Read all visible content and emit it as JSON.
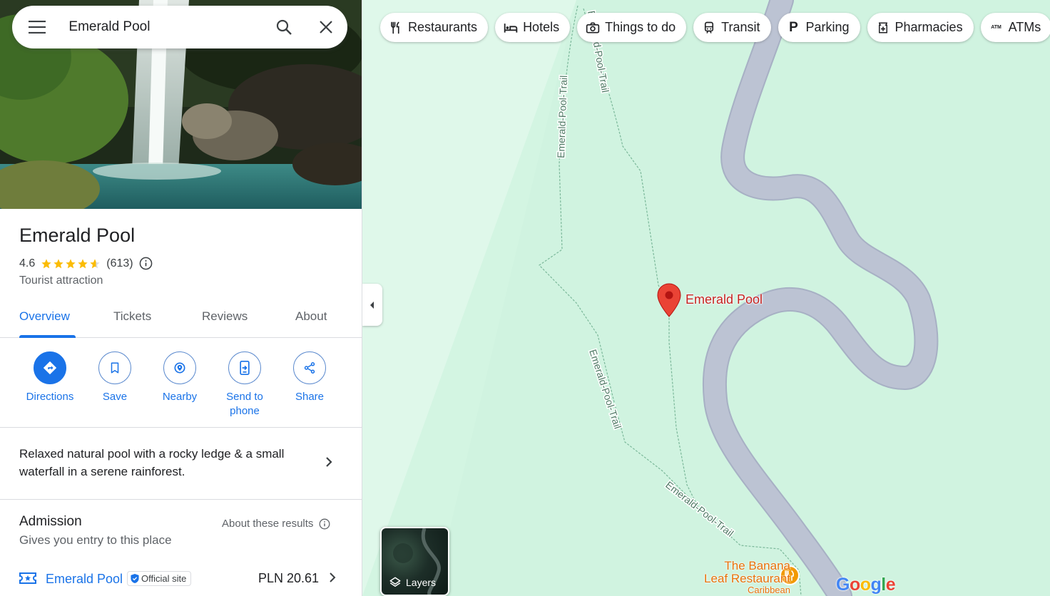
{
  "search": {
    "value": "Emerald Pool"
  },
  "place": {
    "name": "Emerald Pool",
    "rating": "4.6",
    "stars": 4.6,
    "reviews_count": "(613)",
    "category": "Tourist attraction"
  },
  "tabs": [
    {
      "label": "Overview",
      "active": true
    },
    {
      "label": "Tickets",
      "active": false
    },
    {
      "label": "Reviews",
      "active": false
    },
    {
      "label": "About",
      "active": false
    }
  ],
  "actions": [
    {
      "label": "Directions",
      "icon": "directions-icon"
    },
    {
      "label": "Save",
      "icon": "bookmark-icon"
    },
    {
      "label": "Nearby",
      "icon": "nearby-icon"
    },
    {
      "label": "Send to phone",
      "icon": "send-to-phone-icon"
    },
    {
      "label": "Share",
      "icon": "share-icon"
    }
  ],
  "description": "Relaxed natural pool with a rocky ledge & a small waterfall in a serene rainforest.",
  "admission": {
    "title": "Admission",
    "subtitle": "Gives you entry to this place",
    "about_link": "About these results",
    "ticket": {
      "name": "Emerald Pool",
      "badge": "Official site",
      "price": "PLN 20.61"
    }
  },
  "chips": [
    {
      "label": "Restaurants",
      "icon": "restaurant-icon"
    },
    {
      "label": "Hotels",
      "icon": "hotel-icon"
    },
    {
      "label": "Things to do",
      "icon": "camera-icon"
    },
    {
      "label": "Transit",
      "icon": "transit-icon"
    },
    {
      "label": "Parking",
      "icon": "parking-icon"
    },
    {
      "label": "Pharmacies",
      "icon": "pharmacy-icon"
    },
    {
      "label": "ATMs",
      "icon": "atm-icon"
    }
  ],
  "map": {
    "pin_label": "Emerald Pool",
    "trail_label": "Emerald-Pool-Trail",
    "poi": {
      "name_line1": "The Banana",
      "name_line2": "Leaf Restaurant",
      "sub": "Caribbean"
    },
    "layers_label": "Layers",
    "logo": "Google"
  },
  "colors": {
    "accent": "#1a73e8",
    "map_background": "#d3f5e2",
    "road": "#bcc3d3",
    "pin": "#ea4335",
    "poi": "#e8710a",
    "star": "#fbbc04"
  }
}
